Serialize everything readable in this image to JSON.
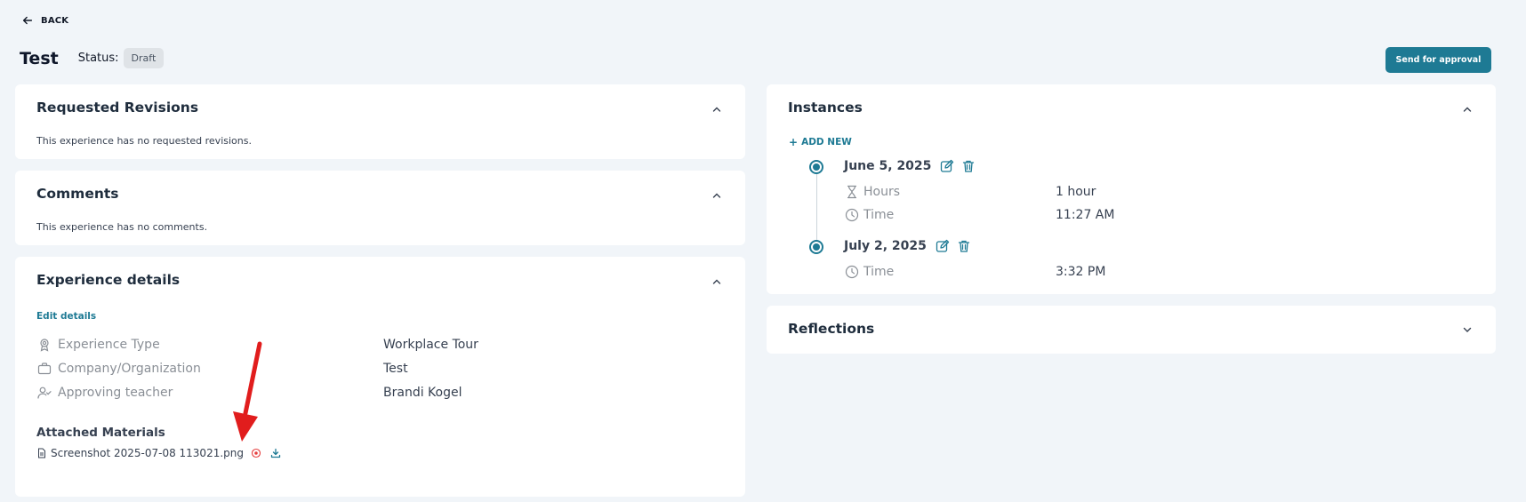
{
  "nav": {
    "back_label": "BACK"
  },
  "header": {
    "title": "Test",
    "status_label": "Status:",
    "status_value": "Draft",
    "approve_button": "Send for approval"
  },
  "revisions": {
    "title": "Requested Revisions",
    "empty_text": "This experience has no requested revisions."
  },
  "comments": {
    "title": "Comments",
    "empty_text": "This experience has no comments."
  },
  "details": {
    "title": "Experience details",
    "edit_link": "Edit details",
    "rows": [
      {
        "label": "Experience Type",
        "value": "Workplace Tour",
        "icon": "award-icon"
      },
      {
        "label": "Company/Organization",
        "value": "Test",
        "icon": "briefcase-icon"
      },
      {
        "label": "Approving teacher",
        "value": "Brandi Kogel",
        "icon": "user-check-icon"
      }
    ],
    "attachments_title": "Attached Materials",
    "attachments": [
      {
        "name": "Screenshot 2025-07-08 113021.png"
      }
    ]
  },
  "instances": {
    "title": "Instances",
    "add_new": "ADD NEW",
    "items": [
      {
        "date": "June 5, 2025",
        "rows": [
          {
            "label": "Hours",
            "value": "1 hour",
            "icon": "hourglass-icon"
          },
          {
            "label": "Time",
            "value": "11:27 AM",
            "icon": "clock-icon"
          }
        ]
      },
      {
        "date": "July 2, 2025",
        "rows": [
          {
            "label": "Time",
            "value": "3:32 PM",
            "icon": "clock-icon"
          }
        ]
      }
    ]
  },
  "reflections": {
    "title": "Reflections"
  },
  "colors": {
    "accent": "#1e7a94",
    "danger": "#e53e3e",
    "annotation_arrow": "#e11d1d",
    "background": "#f1f5f9"
  }
}
